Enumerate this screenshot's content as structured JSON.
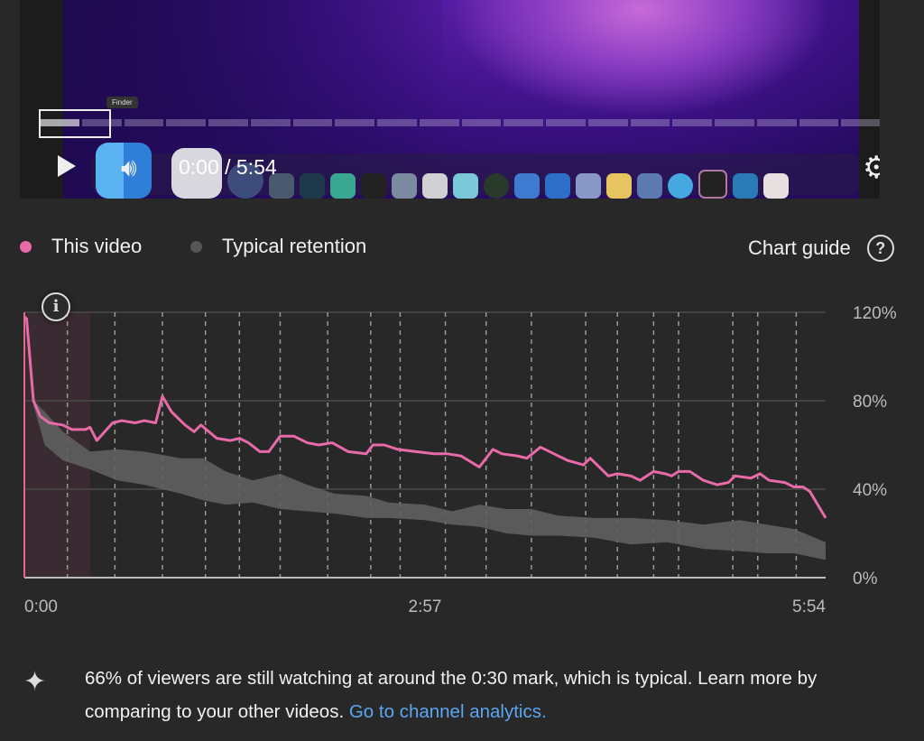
{
  "player": {
    "time_display": "0:00 / 5:54",
    "tooltip": "Finder",
    "icons": [
      "play-icon",
      "volume-icon",
      "settings-gear-icon"
    ],
    "progress_fraction": 0
  },
  "legend": {
    "this_video": {
      "label": "This video",
      "color": "#e86aa8"
    },
    "typical": {
      "label": "Typical retention",
      "color": "#5f5f5f"
    },
    "chart_guide": "Chart guide"
  },
  "chart_data": {
    "type": "line",
    "x_unit": "seconds",
    "xlim": [
      0,
      354
    ],
    "ylim": [
      0,
      120
    ],
    "y_ticks": [
      "120%",
      "80%",
      "40%",
      "0%"
    ],
    "y_tick_values": [
      120,
      80,
      40,
      0
    ],
    "x_ticks": [
      "0:00",
      "2:57",
      "5:54"
    ],
    "x_tick_values": [
      0,
      177,
      354
    ],
    "grid": true,
    "highlight_range": [
      0,
      29
    ],
    "chapter_markers": [
      19,
      40,
      61,
      80,
      95,
      113,
      134,
      153,
      166,
      186,
      204,
      224,
      248,
      262,
      278,
      289,
      313,
      324,
      341
    ],
    "series": [
      {
        "name": "This video",
        "color": "#e86aa8",
        "x": [
          0,
          1,
          4,
          7,
          11,
          17,
          21,
          27,
          29,
          32,
          39,
          43,
          49,
          53,
          58,
          61,
          65,
          71,
          75,
          78,
          85,
          91,
          95,
          99,
          104,
          108,
          113,
          119,
          125,
          130,
          136,
          143,
          151,
          154,
          159,
          165,
          173,
          181,
          187,
          193,
          201,
          207,
          211,
          218,
          222,
          228,
          234,
          240,
          247,
          250,
          258,
          262,
          268,
          272,
          278,
          283,
          286,
          289,
          294,
          300,
          306,
          311,
          314,
          321,
          325,
          329,
          336,
          340,
          344,
          347,
          354
        ],
        "y": [
          118,
          117,
          80,
          73,
          70,
          69,
          67,
          67,
          68,
          62,
          70,
          71,
          70,
          71,
          70,
          82,
          75,
          69,
          66,
          69,
          63,
          62,
          63,
          61,
          57,
          57,
          64,
          64,
          61,
          60,
          61,
          57,
          56,
          60,
          60,
          58,
          57,
          56,
          56,
          55,
          50,
          58,
          56,
          55,
          54,
          59,
          56,
          53,
          51,
          54,
          46,
          47,
          46,
          44,
          48,
          47,
          46,
          48,
          48,
          44,
          42,
          43,
          46,
          45,
          47,
          44,
          43,
          41,
          41,
          39,
          27
        ]
      },
      {
        "name": "Typical retention",
        "color": "#5f5f5f",
        "type": "band",
        "x": [
          4,
          9,
          17,
          29,
          41,
          53,
          69,
          79,
          89,
          101,
          113,
          125,
          137,
          151,
          161,
          177,
          189,
          201,
          213,
          224,
          236,
          252,
          268,
          284,
          300,
          316,
          328,
          340,
          354
        ],
        "upper": [
          80,
          75,
          66,
          57,
          58,
          57,
          54,
          54,
          48,
          44,
          47,
          42,
          38,
          37,
          34,
          33,
          30,
          33,
          31,
          31,
          28,
          27,
          27,
          26,
          24,
          26,
          24,
          22,
          16
        ],
        "lower": [
          78,
          60,
          53,
          49,
          44,
          42,
          38,
          35,
          33,
          34,
          31,
          30,
          29,
          27,
          27,
          26,
          24,
          23,
          20,
          19,
          19,
          18,
          15,
          16,
          13,
          12,
          11,
          11,
          8
        ]
      }
    ]
  },
  "insight": {
    "text": "66% of viewers are still watching at around the 0:30 mark, which is typical. Learn more by comparing to your other videos. ",
    "link": "Go to channel analytics."
  }
}
